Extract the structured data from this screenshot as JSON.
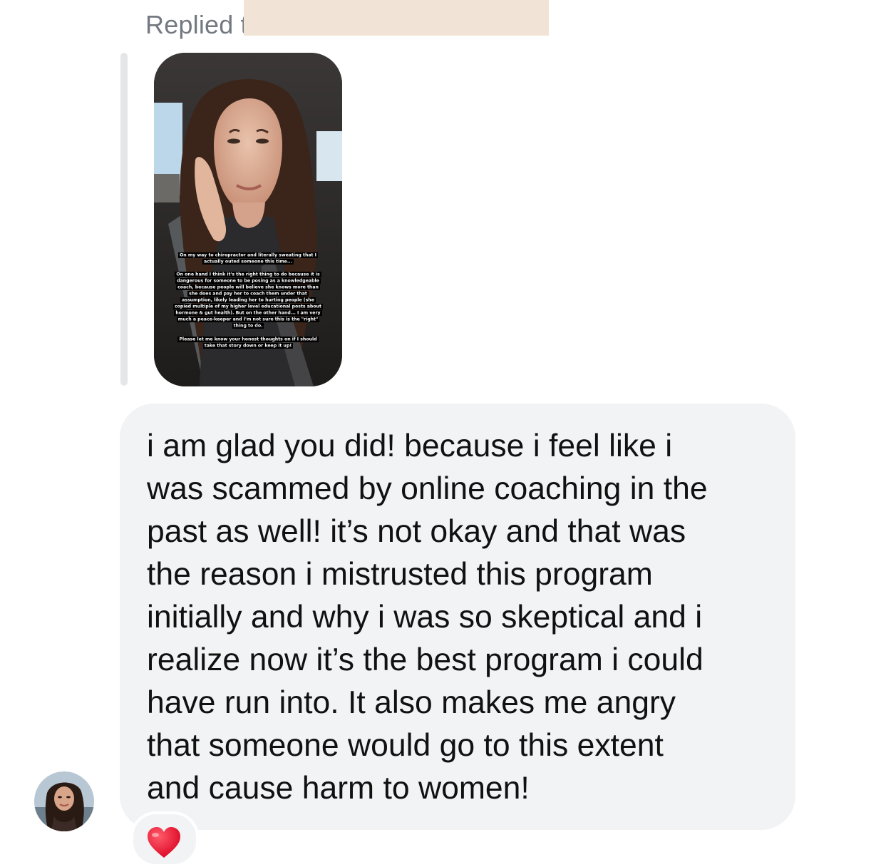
{
  "reply_header": {
    "label": "Replied t"
  },
  "story": {
    "caption_1": "On my way to chiropractor and literally sweating that I actually outed someone this time...",
    "caption_2": "On one hand I think it's the right thing to do because it is dangerous for someone to be posing as a knowledgeable coach, because people will believe she knows more than she does and pay her to coach them under that assumption, likely leading her to hurting people (she copied multiple of my higher level educational posts about hormone & gut health). But on the other hand... I am very much a peace-keeper and I'm not sure this is the \"right\" thing to do.",
    "caption_3": "Please let me know your honest thoughts on if I should take that story down or keep it up!"
  },
  "message": {
    "lines": [
      "i am glad you did! because i feel like i",
      "was scammed by online coaching in the",
      "past as well! it’s not okay and that was",
      "the reason i mistrusted this program",
      "initially and why i was so skeptical and i",
      "realize now it’s the best program i could",
      "have run into. It also makes me angry",
      "that someone would go to this extent",
      "and cause harm to women!"
    ]
  },
  "reaction": {
    "icon": "red-heart-icon",
    "color": "#e8112d"
  },
  "colors": {
    "bubble": "#f2f3f5",
    "quote_bar": "#e4e6ea",
    "muted_text": "#737981",
    "redaction": "#f1e4d6"
  }
}
